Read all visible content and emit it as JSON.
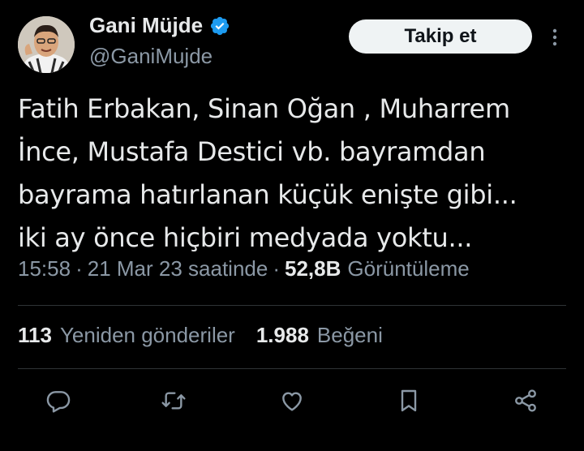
{
  "author": {
    "display_name": "Gani Müjde",
    "handle": "@GaniMujde",
    "verified_icon": "verified-badge-icon",
    "avatar_icon": "avatar-photo"
  },
  "follow_button": {
    "label": "Takip et"
  },
  "tweet": {
    "text": "Fatih Erbakan, Sinan Oğan , Muharrem\nİnce, Mustafa Destici vb. bayramdan\nbayrama hatırlanan küçük enişte gibi...\niki ay önce hiçbiri medyada yoktu..."
  },
  "meta": {
    "time": "15:58",
    "separator": "·",
    "date": "21 Mar 23 saatinde",
    "views_count": "52,8B",
    "views_label": "Görüntüleme"
  },
  "stats": {
    "retweets_count": "113",
    "retweets_label": "Yeniden gönderiler",
    "likes_count": "1.988",
    "likes_label": "Beğeni"
  },
  "actions": [
    "reply-icon",
    "retweet-icon",
    "like-icon",
    "bookmark-icon",
    "share-icon"
  ],
  "colors": {
    "background": "#000000",
    "text": "#e7e9ea",
    "secondary_text": "#8b98a5",
    "verified": "#1d9bf0",
    "follow_bg": "#eff3f4",
    "divider": "#2f3336"
  }
}
